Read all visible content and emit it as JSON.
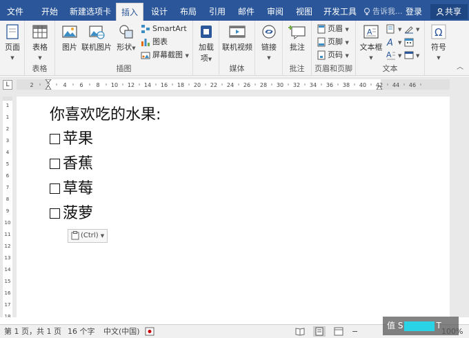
{
  "tabs": [
    {
      "label": "文件",
      "active": false
    },
    {
      "label": "开始",
      "active": false
    },
    {
      "label": "新建选项卡",
      "active": false
    },
    {
      "label": "插入",
      "active": true
    },
    {
      "label": "设计",
      "active": false
    },
    {
      "label": "布局",
      "active": false
    },
    {
      "label": "引用",
      "active": false
    },
    {
      "label": "邮件",
      "active": false
    },
    {
      "label": "审阅",
      "active": false
    },
    {
      "label": "视图",
      "active": false
    },
    {
      "label": "开发工具",
      "active": false
    }
  ],
  "tell_me": "告诉我...",
  "login": "登录",
  "share": "共享",
  "ribbon": {
    "page": {
      "button": "页面"
    },
    "table": {
      "button": "表格",
      "group": "表格"
    },
    "illustrations": {
      "group": "插图",
      "picture": "图片",
      "online_picture": "联机图片",
      "shapes": "形状",
      "smartart": "SmartArt",
      "chart": "图表",
      "screenshot": "屏幕截图"
    },
    "addins": {
      "button_line1": "加载",
      "button_line2": "项"
    },
    "media": {
      "group": "媒体",
      "online_video": "联机视频"
    },
    "links": {
      "button": "链接"
    },
    "comments": {
      "group": "批注",
      "button": "批注"
    },
    "header_footer": {
      "group": "页眉和页脚",
      "header": "页眉",
      "footer": "页脚",
      "page_number": "页码"
    },
    "text": {
      "group": "文本",
      "textbox": "文本框"
    },
    "symbols": {
      "button": "符号"
    }
  },
  "ruler": {
    "corner": "L",
    "ticks": [
      "2",
      "2",
      "4",
      "6",
      "8",
      "10",
      "12",
      "14",
      "16",
      "18",
      "20",
      "22",
      "24",
      "26",
      "28",
      "30",
      "32",
      "34",
      "36",
      "38",
      "40",
      "42",
      "44",
      "46"
    ],
    "vticks": [
      "1",
      "1",
      "2",
      "3",
      "4",
      "5",
      "6",
      "7",
      "8",
      "9",
      "10",
      "11",
      "12",
      "13",
      "14",
      "15",
      "16",
      "17",
      "18"
    ]
  },
  "document": {
    "lines": [
      "你喜欢吃的水果:",
      "苹果",
      "香蕉",
      "草莓",
      "菠萝"
    ],
    "paste_label": "(Ctrl)"
  },
  "status": {
    "page": "第 1 页，共 1 页",
    "words": "16 个字",
    "language": "中文(中国)",
    "zoom": "100%"
  },
  "watermark": {
    "prefix": "值",
    "suffix": "T"
  },
  "colors": {
    "brand": "#2b579a",
    "ribbon_bg": "#f3f3f3",
    "watermark_highlight": "#2bd3e6"
  }
}
